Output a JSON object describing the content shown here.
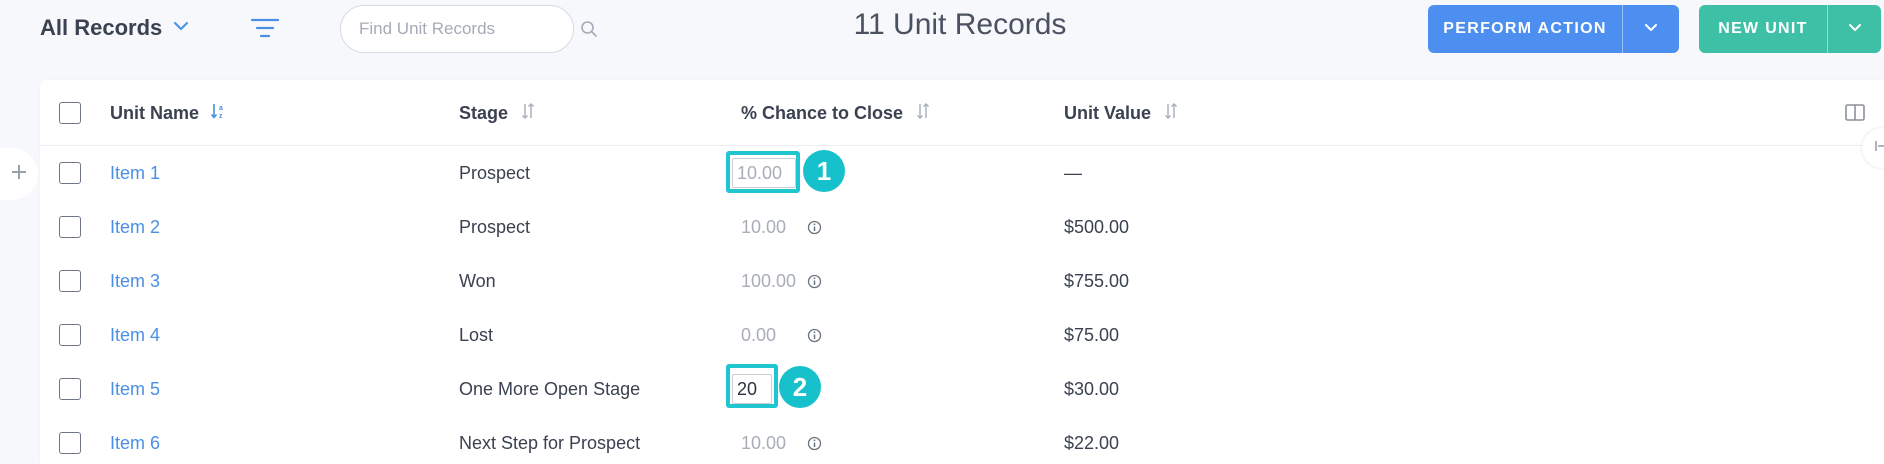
{
  "toolbar": {
    "view_label": "All Records",
    "search_placeholder": "Find Unit Records",
    "records_title": "11 Unit Records",
    "perform_action_label": "PERFORM ACTION",
    "new_unit_label": "NEW UNIT",
    "icons": [
      "chevron-down-icon",
      "filter-icon",
      "search-icon"
    ]
  },
  "colors": {
    "primary_blue": "#4c8ff0",
    "teal": "#3ec0a7",
    "link": "#4a8fe6",
    "highlight": "#1fc5cf"
  },
  "table": {
    "columns": {
      "unit_name": "Unit Name",
      "stage": "Stage",
      "chance": "% Chance to Close",
      "value": "Unit Value"
    },
    "rows": [
      {
        "name": "Item 1",
        "stage": "Prospect",
        "chance": "10.00",
        "value": "—"
      },
      {
        "name": "Item 2",
        "stage": "Prospect",
        "chance": "10.00",
        "value": "$500.00"
      },
      {
        "name": "Item 3",
        "stage": "Won",
        "chance": "100.00",
        "value": "$755.00"
      },
      {
        "name": "Item 4",
        "stage": "Lost",
        "chance": "0.00",
        "value": "$75.00"
      },
      {
        "name": "Item 5",
        "stage": "One More Open Stage",
        "chance": "20",
        "value": "$30.00"
      },
      {
        "name": "Item 6",
        "stage": "Next Step for Prospect",
        "chance": "10.00",
        "value": "$22.00"
      }
    ]
  },
  "annotations": {
    "step1": "1",
    "step2": "2"
  }
}
